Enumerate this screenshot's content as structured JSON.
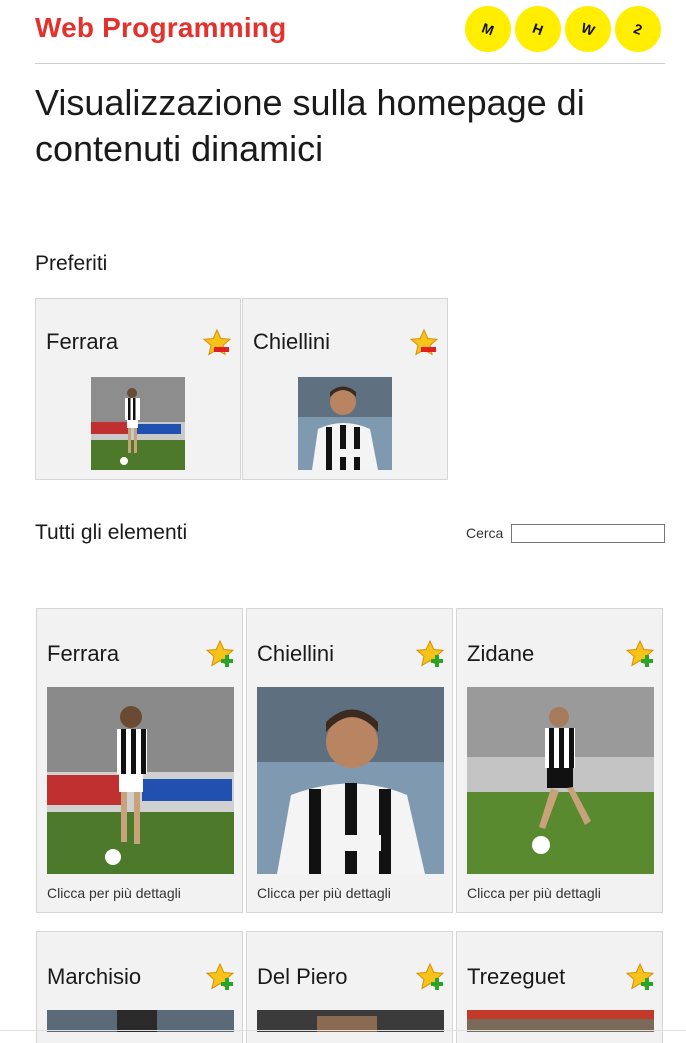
{
  "header": {
    "brand": "Web Programming",
    "badges": [
      "M",
      "H",
      "W",
      "2"
    ]
  },
  "page_title": "Visualizzazione sulla homepage di contenuti dinamici",
  "favorites": {
    "title": "Preferiti",
    "items": [
      {
        "name": "Ferrara",
        "star": "star-remove-icon"
      },
      {
        "name": "Chiellini",
        "star": "star-remove-icon"
      }
    ]
  },
  "all_items": {
    "title": "Tutti gli elementi",
    "search_label": "Cerca",
    "search_value": "",
    "caption": "Clicca per più dettagli",
    "items": [
      {
        "name": "Ferrara",
        "star": "star-add-icon"
      },
      {
        "name": "Chiellini",
        "star": "star-add-icon"
      },
      {
        "name": "Zidane",
        "star": "star-add-icon"
      },
      {
        "name": "Marchisio",
        "star": "star-add-icon"
      },
      {
        "name": "Del Piero",
        "star": "star-add-icon"
      },
      {
        "name": "Trezeguet",
        "star": "star-add-icon"
      }
    ]
  },
  "colors": {
    "brand": "#e5312b",
    "badge": "#ffee00",
    "card_bg": "#f2f2f2"
  }
}
